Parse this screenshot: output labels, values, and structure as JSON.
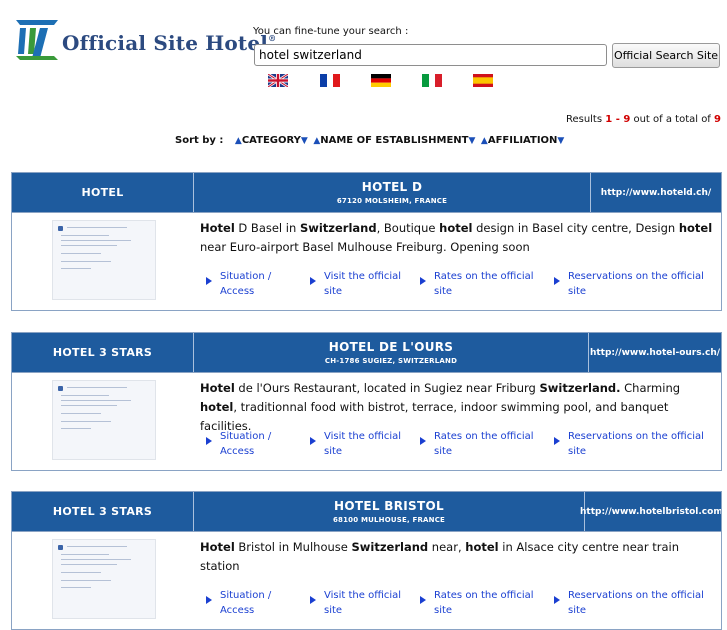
{
  "brand": {
    "name": "Official Site Hotel",
    "registered": "®"
  },
  "search": {
    "hint": "You can fine-tune your search :",
    "value": "hotel switzerland",
    "button_label": "Official Search Site"
  },
  "flags": [
    "uk-flag-icon",
    "france-flag-icon",
    "germany-flag-icon",
    "italy-flag-icon",
    "spain-flag-icon"
  ],
  "results": {
    "prefix": "Results",
    "range": "1 - 9",
    "middle": "out of a total of",
    "total": "9"
  },
  "sort": {
    "label": "Sort by :",
    "options": [
      "CATEGORY",
      "NAME OF ESTABLISHMENT",
      "AFFILIATION"
    ]
  },
  "link_labels": {
    "situation": "Situation / Access",
    "visit": "Visit the official site",
    "rates": "Rates on the official site",
    "reservations": "Reservations on the official site"
  },
  "colors": {
    "header_bg": "#1e5b9e",
    "link": "#1a3fd1",
    "highlight": "#d10000",
    "brand": "#2c4a80"
  },
  "hotels": [
    {
      "category": "HOTEL",
      "name": "HOTEL D",
      "location": "67120 MOLSHEIM, FRANCE",
      "url": "http://www.hoteld.ch/",
      "description": [
        {
          "t": "Hotel",
          "b": true
        },
        {
          "t": " D Basel in "
        },
        {
          "t": "Switzerland",
          "b": true
        },
        {
          "t": ", Boutique "
        },
        {
          "t": "hotel",
          "b": true
        },
        {
          "t": " design in Basel city centre, Design "
        },
        {
          "t": "hotel",
          "b": true
        },
        {
          "t": " near Euro-airport Basel Mulhouse Freiburg. Opening soon"
        }
      ]
    },
    {
      "category": "HOTEL 3 STARS",
      "name": "HOTEL DE L'OURS",
      "location": "CH-1786 SUGIEZ, SWITZERLAND",
      "url": "http://www.hotel-ours.ch/",
      "description": [
        {
          "t": "Hotel",
          "b": true
        },
        {
          "t": " de l'Ours Restaurant, located in Sugiez near Friburg "
        },
        {
          "t": "Switzerland.",
          "b": true
        },
        {
          "t": " Charming "
        },
        {
          "t": "hotel",
          "b": true
        },
        {
          "t": ", traditionnal food with bistrot, terrace, indoor swimming pool, and banquet facilities."
        }
      ]
    },
    {
      "category": "HOTEL 3 STARS",
      "name": "HOTEL BRISTOL",
      "location": "68100 MULHOUSE, FRANCE",
      "url": "http://www.hotelbristol.com/",
      "description": [
        {
          "t": "Hotel",
          "b": true
        },
        {
          "t": " Bristol in Mulhouse "
        },
        {
          "t": "Switzerland",
          "b": true
        },
        {
          "t": " near, "
        },
        {
          "t": "hotel",
          "b": true
        },
        {
          "t": " in Alsace city centre near train station"
        }
      ]
    }
  ]
}
